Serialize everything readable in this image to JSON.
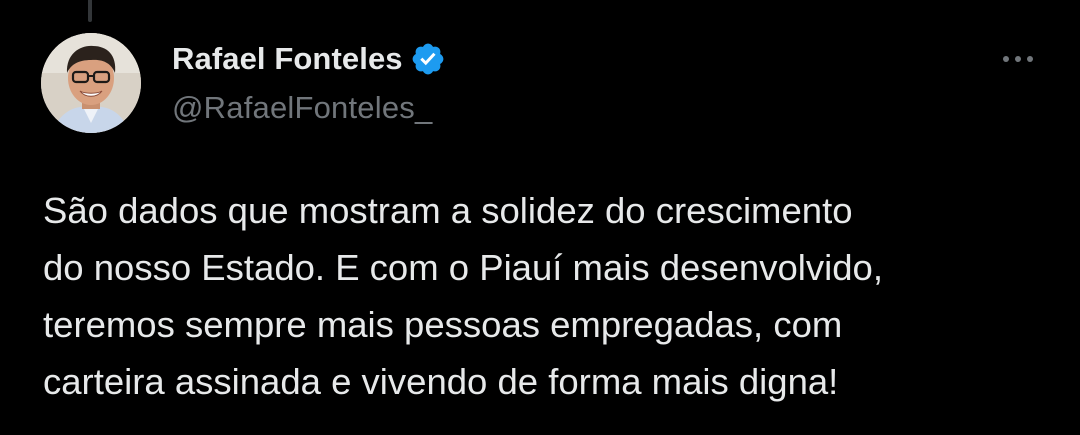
{
  "tweet": {
    "author": {
      "display_name": "Rafael Fonteles",
      "handle": "@RafaelFonteles_",
      "verified": true
    },
    "text_lines": [
      "São dados que mostram a solidez do crescimento",
      "do nosso Estado. E com o Piauí mais desenvolvido,",
      "teremos sempre mais pessoas empregadas, com",
      "carteira assinada e vivendo de forma mais digna!"
    ]
  },
  "colors": {
    "background": "#000000",
    "primary_text": "#e7e9ea",
    "secondary_text": "#71767b",
    "verified_badge": "#1d9bf0",
    "thread_line": "#333639"
  },
  "icons": {
    "verified": "verified-badge-icon",
    "more": "more-options-icon"
  }
}
